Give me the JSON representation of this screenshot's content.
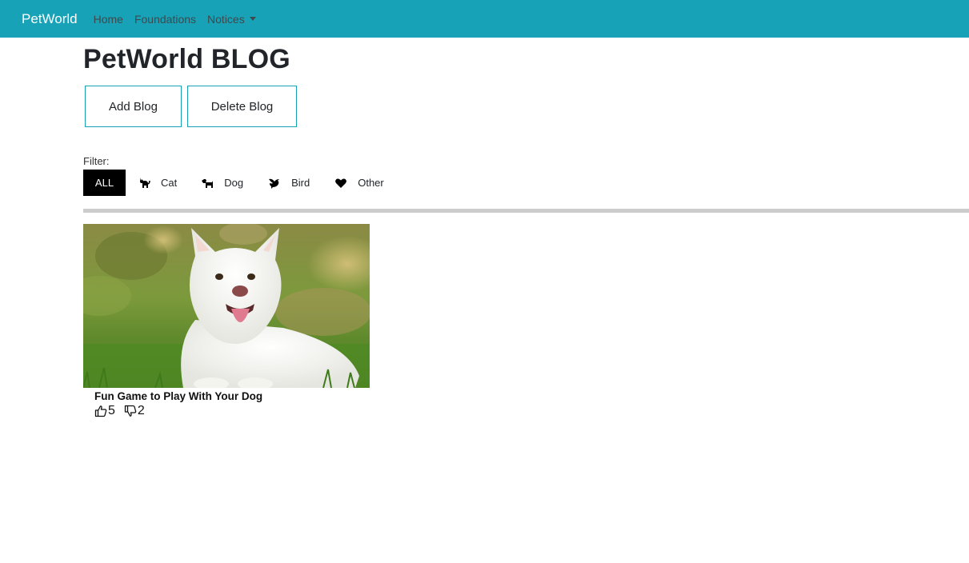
{
  "navbar": {
    "brand": "PetWorld",
    "links": [
      "Home",
      "Foundations",
      "Notices"
    ],
    "background": "#17a2b8"
  },
  "page": {
    "title": "PetWorld BLOG"
  },
  "actions": {
    "add_label": "Add Blog",
    "delete_label": "Delete Blog"
  },
  "filter": {
    "label": "Filter:",
    "options": [
      {
        "label": "ALL",
        "icon": "",
        "active": true
      },
      {
        "label": "Cat",
        "icon": "cat-icon",
        "active": false
      },
      {
        "label": "Dog",
        "icon": "dog-icon",
        "active": false
      },
      {
        "label": "Bird",
        "icon": "bird-icon",
        "active": false
      },
      {
        "label": "Other",
        "icon": "heart-icon",
        "active": false
      }
    ]
  },
  "posts": [
    {
      "title": "Fun Game to Play With Your Dog",
      "image": "white-dog-on-grass",
      "likes": "5",
      "dislikes": "2"
    }
  ]
}
